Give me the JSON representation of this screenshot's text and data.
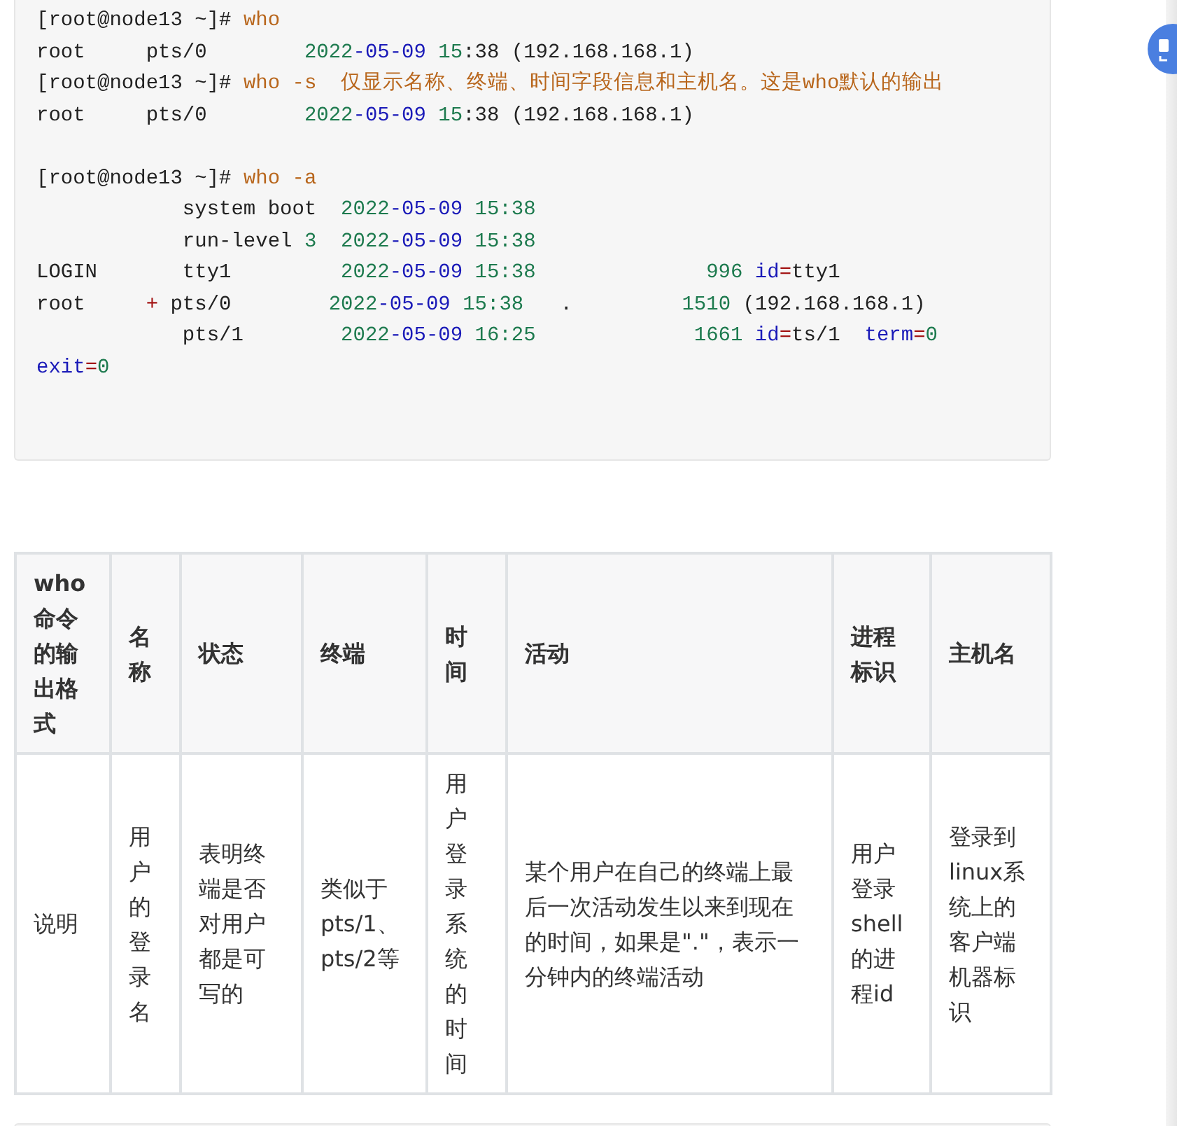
{
  "code_block": {
    "lines": [
      {
        "segments": [
          {
            "kind": "plain",
            "text": "[root@node13 ~]# "
          },
          {
            "kind": "keyword",
            "text": "who"
          }
        ]
      },
      {
        "segments": [
          {
            "kind": "plain",
            "text": "root     pts/0        "
          },
          {
            "kind": "number",
            "text": "2022"
          },
          {
            "kind": "blue",
            "text": "-05-09 "
          },
          {
            "kind": "number",
            "text": "15"
          },
          {
            "kind": "plain",
            "text": ":38 (192.168.168.1)"
          }
        ]
      },
      {
        "segments": [
          {
            "kind": "plain",
            "text": "[root@node13 ~]# "
          },
          {
            "kind": "keyword",
            "text": "who -s  仅显示名称、终端、时间字段信息和主机名。这是who默认的输出"
          }
        ]
      },
      {
        "segments": [
          {
            "kind": "plain",
            "text": "root     pts/0        "
          },
          {
            "kind": "number",
            "text": "2022"
          },
          {
            "kind": "blue",
            "text": "-05-09 "
          },
          {
            "kind": "number",
            "text": "15"
          },
          {
            "kind": "plain",
            "text": ":38 (192.168.168.1)"
          }
        ]
      },
      {
        "kind": "blank"
      },
      {
        "segments": [
          {
            "kind": "plain",
            "text": "[root@node13 ~]# "
          },
          {
            "kind": "keyword",
            "text": "who -a"
          }
        ]
      },
      {
        "segments": [
          {
            "kind": "plain",
            "text": "            system boot  "
          },
          {
            "kind": "number",
            "text": "2022"
          },
          {
            "kind": "blue",
            "text": "-05-09"
          },
          {
            "kind": "number",
            "text": " 15:38"
          }
        ]
      },
      {
        "segments": [
          {
            "kind": "plain",
            "text": "            run-level "
          },
          {
            "kind": "number",
            "text": "3  2022"
          },
          {
            "kind": "blue",
            "text": "-05-09"
          },
          {
            "kind": "number",
            "text": " 15:38"
          }
        ]
      },
      {
        "segments": [
          {
            "kind": "plain",
            "text": "LOGIN       tty1         "
          },
          {
            "kind": "number",
            "text": "2022"
          },
          {
            "kind": "blue",
            "text": "-05-09"
          },
          {
            "kind": "number",
            "text": " 15:38              996 "
          },
          {
            "kind": "blue",
            "text": "id"
          },
          {
            "kind": "op",
            "text": "="
          },
          {
            "kind": "plain",
            "text": "tty1"
          }
        ]
      },
      {
        "segments": [
          {
            "kind": "plain",
            "text": "root     "
          },
          {
            "kind": "op",
            "text": "+"
          },
          {
            "kind": "plain",
            "text": " pts/0        "
          },
          {
            "kind": "number",
            "text": "2022"
          },
          {
            "kind": "blue",
            "text": "-05-09"
          },
          {
            "kind": "number",
            "text": " 15:38"
          },
          {
            "kind": "plain",
            "text": "   .         "
          },
          {
            "kind": "number",
            "text": "1510"
          },
          {
            "kind": "plain",
            "text": " (192.168.168.1)"
          }
        ]
      },
      {
        "segments": [
          {
            "kind": "plain",
            "text": "            pts/1        "
          },
          {
            "kind": "number",
            "text": "2022"
          },
          {
            "kind": "blue",
            "text": "-05-09"
          },
          {
            "kind": "number",
            "text": " 16:25             1661 "
          },
          {
            "kind": "blue",
            "text": "id"
          },
          {
            "kind": "op",
            "text": "="
          },
          {
            "kind": "plain",
            "text": "ts/1  "
          },
          {
            "kind": "blue",
            "text": "term"
          },
          {
            "kind": "op",
            "text": "="
          },
          {
            "kind": "number",
            "text": "0"
          }
        ]
      },
      {
        "segments": [
          {
            "kind": "blue",
            "text": "exit"
          },
          {
            "kind": "op",
            "text": "="
          },
          {
            "kind": "number",
            "text": "0"
          }
        ]
      }
    ]
  },
  "table": {
    "columns": [
      "who命令的输出格式",
      "名称",
      "状态",
      "终端",
      "时间",
      "活动",
      "进程标识",
      "主机名"
    ],
    "rows": [
      {
        "cells": [
          "说明",
          "用户的登录名",
          "表明终端是否对用户都是可写的",
          "类似于pts/1、pts/2等",
          "用户登录系统的时间",
          "某个用户在自己的终端上最后一次活动发生以来到现在的时间，如果是\".\"，表示一分钟内的终端活动",
          "用户登录shell的进程id",
          "登录到linux系统上的客户端机器标识"
        ]
      }
    ]
  }
}
